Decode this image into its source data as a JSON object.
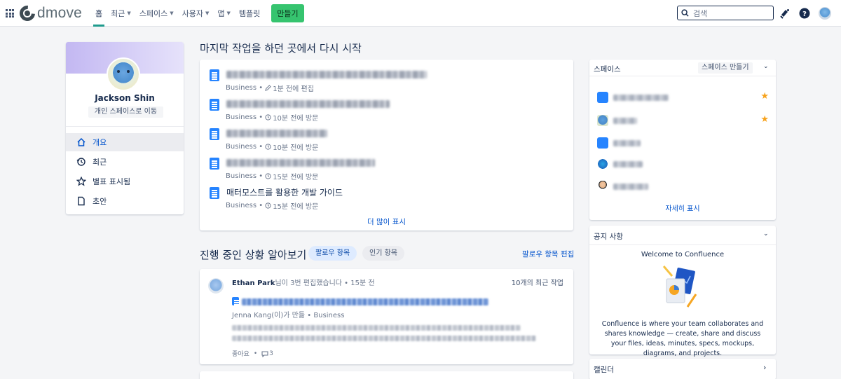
{
  "topnav": {
    "logo_text": "dmove",
    "items": [
      {
        "label": "홈",
        "active": true,
        "chevron": false
      },
      {
        "label": "최근",
        "chevron": true
      },
      {
        "label": "스페이스",
        "chevron": true
      },
      {
        "label": "사용자",
        "chevron": true
      },
      {
        "label": "앱",
        "chevron": true
      },
      {
        "label": "템플릿",
        "chevron": false
      }
    ],
    "create_label": "만들기",
    "search_placeholder": "검색",
    "accent": "#1f9b8d",
    "create_color": "#36c46f"
  },
  "profile": {
    "name": "Jackson Shin",
    "personal_space_link": "개인 스페이스로 이동",
    "menu": [
      {
        "label": "개요",
        "icon": "home-icon",
        "active": true
      },
      {
        "label": "최근",
        "icon": "history-icon"
      },
      {
        "label": "별표 표시됨",
        "icon": "star-icon"
      },
      {
        "label": "초안",
        "icon": "draft-icon"
      }
    ]
  },
  "recent": {
    "title": "마지막 작업을 하던 곳에서 다시 시작",
    "items": [
      {
        "title": "",
        "space": "Business",
        "meta": "1분 전에 편집",
        "meta_icon": "pencil-icon"
      },
      {
        "title": "",
        "space": "Business",
        "meta": "10분 전에 방문",
        "meta_icon": "clock-icon"
      },
      {
        "title": "",
        "space": "Business",
        "meta": "10분 전에 방문",
        "meta_icon": "clock-icon"
      },
      {
        "title": "",
        "space": "Business",
        "meta": "15분 전에 방문",
        "meta_icon": "clock-icon"
      },
      {
        "title": "매터모스트를 활용한 개발 가이드",
        "space": "Business",
        "meta": "15분 전에 방문",
        "meta_icon": "clock-icon"
      }
    ],
    "more_label": "더 많이 표시"
  },
  "progress": {
    "title": "진행 중인 상황 알아보기",
    "tab_following": "팔로우 항목",
    "tab_popular": "인기 항목",
    "edit_following": "팔로우 항목 편집",
    "feed": {
      "author": "Ethan Park",
      "action": "님이 3번 편집했습니다 • 15분 전",
      "recent_count": "10개의 최근 작업",
      "page_creator": "Jenna Kang(이)가 만듦 • Business",
      "like_label": "좋아요",
      "comment_count": "3"
    }
  },
  "spaces": {
    "title": "스페이스",
    "create_label": "스페이스 만들기",
    "more_label": "자세히 표시"
  },
  "notice": {
    "title": "공지 사항",
    "welcome_title": "Welcome to Confluence",
    "welcome_body": "Confluence is where your team collaborates and shares knowledge — create, share and discuss your files, ideas, minutes, specs, mockups, diagrams, and projects."
  },
  "calendar": {
    "title": "캘린더"
  }
}
